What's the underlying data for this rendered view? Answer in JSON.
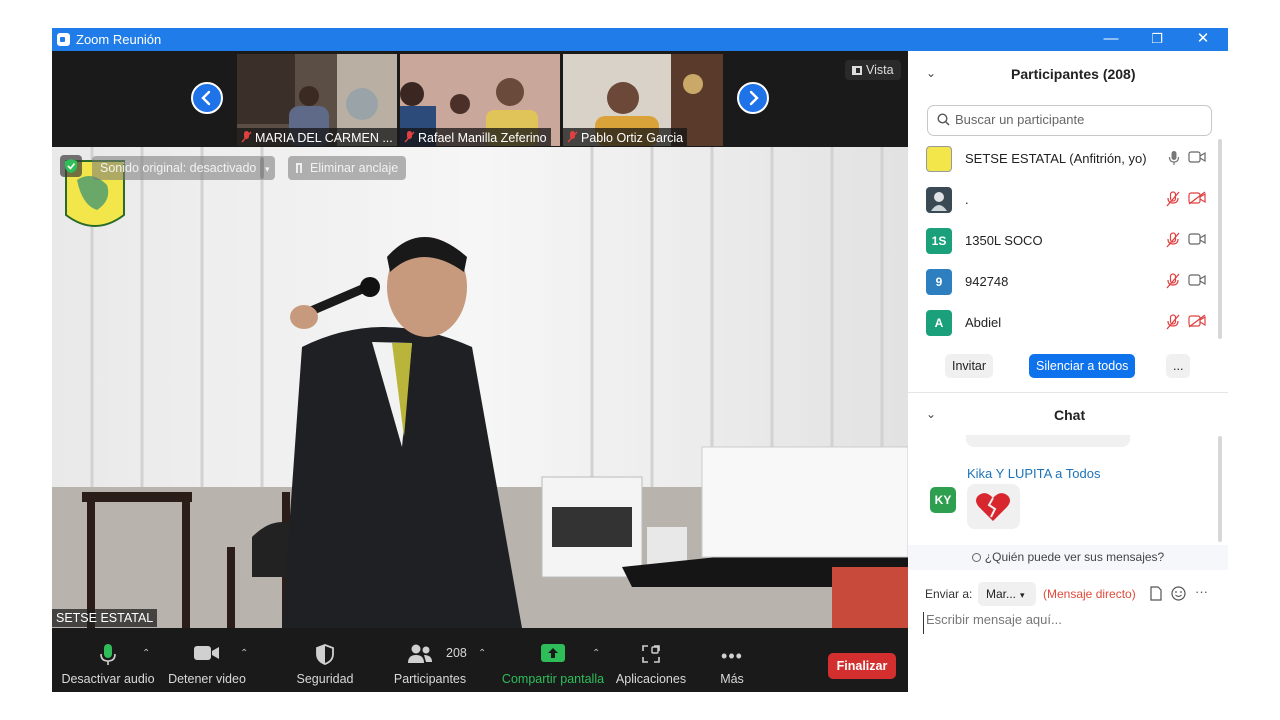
{
  "window": {
    "title": "Zoom Reunión",
    "minimize_glyph": "—",
    "restore_glyph": "❐",
    "close_glyph": "✕"
  },
  "strip": {
    "participants": [
      {
        "name": "MARIA DEL CARMEN ..."
      },
      {
        "name": "Rafael Manilla Zeferino"
      },
      {
        "name": "Pablo Ortiz Garcia"
      }
    ],
    "view_label": "Vista"
  },
  "main_video": {
    "original_sound": "Sonido original: desactivado",
    "unpin": "Eliminar anclaje",
    "speaker_name": "SETSE ESTATAL"
  },
  "toolbar": {
    "mute_audio": "Desactivar audio",
    "stop_video": "Detener video",
    "security": "Seguridad",
    "participants": "Participantes",
    "participants_count": "208",
    "share_screen": "Compartir pantalla",
    "apps": "Aplicaciones",
    "more": "Más",
    "end": "Finalizar"
  },
  "participants_panel": {
    "title": "Participantes (208)",
    "search_placeholder": "Buscar un participante",
    "list": [
      {
        "name": "SETSE ESTATAL (Anfitrión, yo)",
        "avatar": "logo"
      },
      {
        "name": ".",
        "avatar": "image"
      },
      {
        "name": "1350L SOCO",
        "avatar": "1S",
        "avatar_color": "#1aa07a"
      },
      {
        "name": "942748",
        "avatar": "9",
        "avatar_color": "#2d7fbf"
      },
      {
        "name": "Abdiel",
        "avatar": "A",
        "avatar_color": "#1aa07a"
      }
    ],
    "invite": "Invitar",
    "mute_all": "Silenciar a todos",
    "more": "..."
  },
  "chat_panel": {
    "title": "Chat",
    "messages": [
      {
        "sender": "Kika Y LUPITA",
        "to_word": "a",
        "recipient": "Todos",
        "avatar": "KY",
        "avatar_color": "#2e9e4f",
        "content": "broken-heart-emoji"
      }
    ],
    "who_can_see": "¿Quién puede ver sus mensajes?",
    "send_to_label": "Enviar a:",
    "recipient_select": "Mar...",
    "direct_message": "(Mensaje directo)",
    "more": "···",
    "input_placeholder": "Escribir mensaje aquí..."
  }
}
